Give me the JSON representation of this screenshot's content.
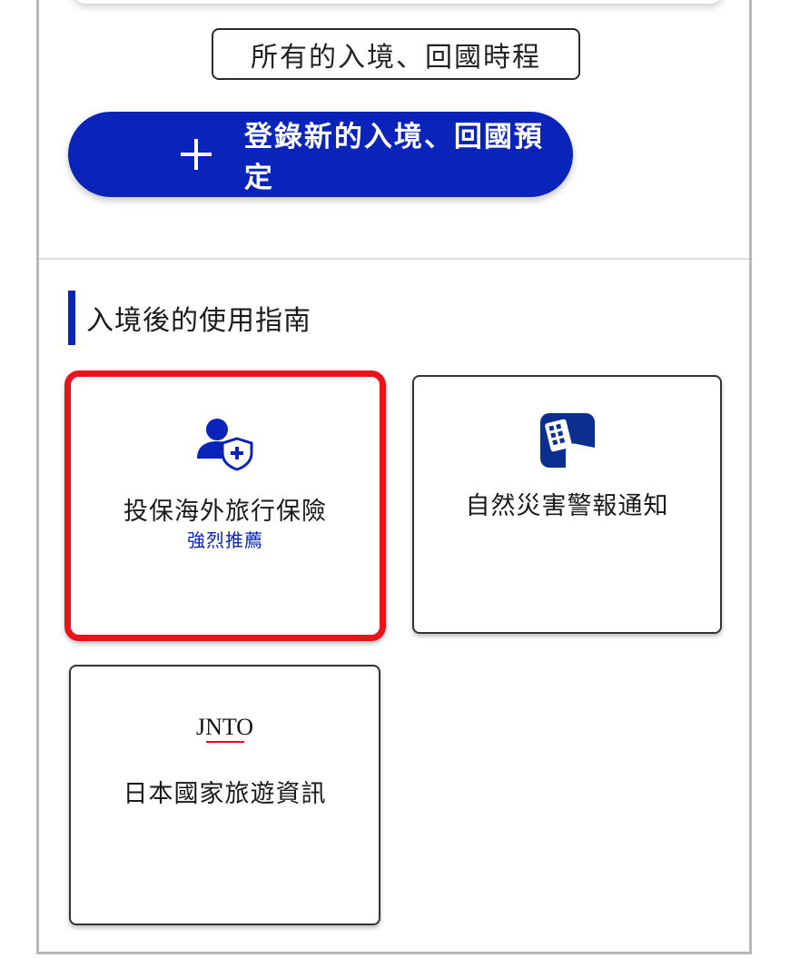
{
  "schedule": {
    "all_schedules_label": "所有的入境、回國時程",
    "register_label": "登錄新的入境、回國預定"
  },
  "guide": {
    "section_title": "入境後的使用指南",
    "cards": [
      {
        "title": "投保海外旅行保險",
        "subtitle": "強烈推薦",
        "icon": "user-shield-icon",
        "highlighted": true
      },
      {
        "title": "自然災害警報通知",
        "icon": "disaster-alert-app-icon"
      },
      {
        "title": "日本國家旅遊資訊",
        "logo_text": "JNTO",
        "icon": "jnto-logo"
      }
    ]
  },
  "colors": {
    "brand_blue": "#0a23b8",
    "highlight_red": "#e8141a"
  }
}
